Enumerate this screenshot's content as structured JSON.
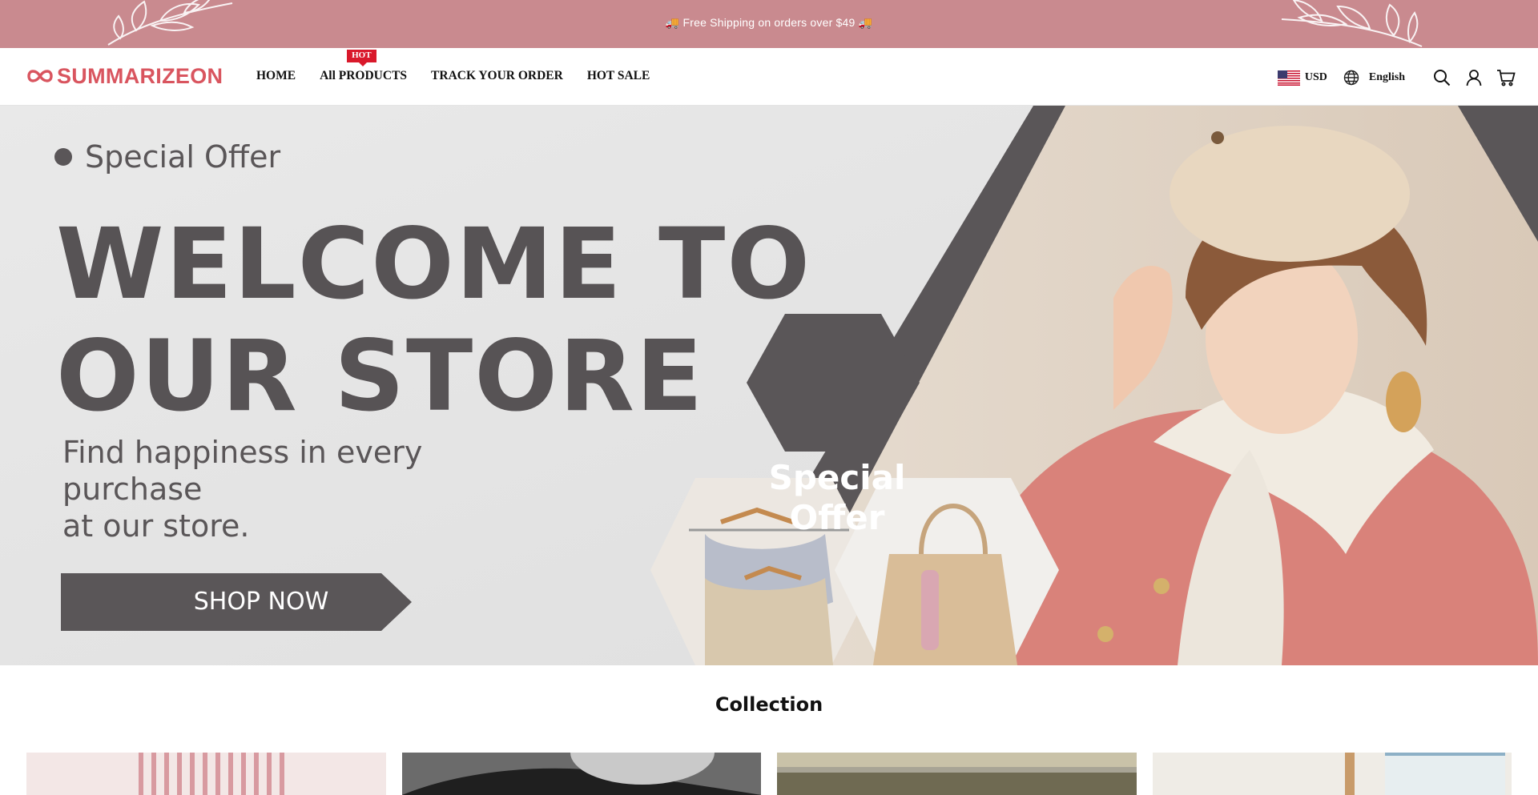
{
  "announcement": {
    "text": "🚚 Free Shipping on orders over $49 🚚"
  },
  "header": {
    "logo_text": "SUMMARIZEON",
    "nav": [
      {
        "label": "HOME"
      },
      {
        "label": "All PRODUCTS",
        "badge": "HOT"
      },
      {
        "label": "TRACK YOUR ORDER"
      },
      {
        "label": "HOT SALE"
      }
    ],
    "currency": "USD",
    "language": "English",
    "icons": [
      "us-flag-icon",
      "globe-icon",
      "search-icon",
      "account-icon",
      "cart-icon"
    ]
  },
  "hero": {
    "tag": "Special Offer",
    "title_line1": "WELCOME TO",
    "title_line2": "OUR STORE",
    "subtitle_line1": "Find happiness in every purchase",
    "subtitle_line2": "at our store.",
    "cta": "SHOP NOW",
    "hex_line1": "Special",
    "hex_line2": "Offer"
  },
  "collection": {
    "title": "Collection",
    "cards": [
      "striped-shirt",
      "dark-apparel",
      "outdoor-scene",
      "green-leaves-box"
    ]
  },
  "colors": {
    "announcement_bg": "#c98a8f",
    "brand": "#d9555f",
    "hot_badge": "#d9192b",
    "hero_text": "#575355"
  }
}
